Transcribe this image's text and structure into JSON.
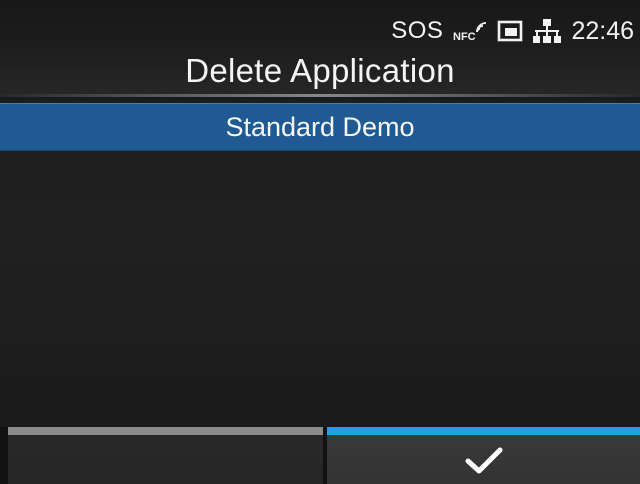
{
  "status": {
    "sos": "SOS",
    "icons": [
      "nfc-icon",
      "sd-card-icon",
      "network-icon"
    ],
    "time": "22:46"
  },
  "title": "Delete Application",
  "list": {
    "items": [
      {
        "label": "Standard Demo",
        "selected": true
      }
    ]
  },
  "softkeys": {
    "left": {
      "label": "",
      "bar_color": "#8c8c8c"
    },
    "right": {
      "icon": "check-icon",
      "bar_color": "#1aa3e6"
    }
  },
  "colors": {
    "selection": "#1f5a92",
    "accent": "#1aa3e6",
    "background": "#1a1a1a"
  }
}
